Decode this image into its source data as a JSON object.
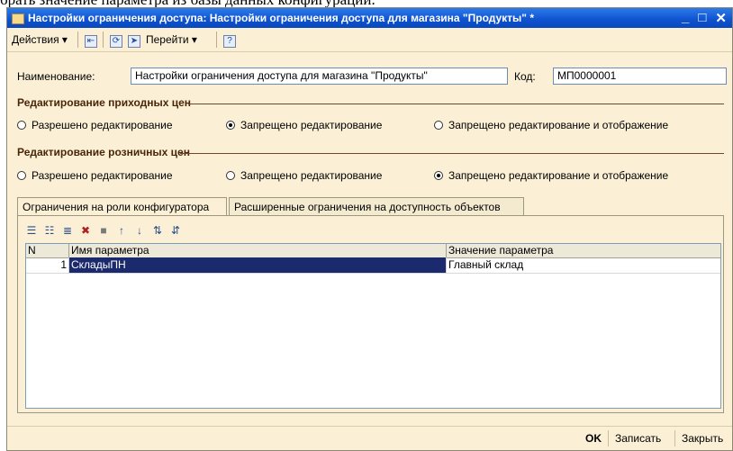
{
  "caption": "брать значение параметра из базы данных конфигурации.",
  "window": {
    "title": "Настройки ограничения доступа: Настройки ограничения доступа для магазина \"Продукты\" *",
    "min_glyph": "_",
    "max_glyph": "□",
    "close_glyph": "✕"
  },
  "toolbar": {
    "actions_label": "Действия",
    "goto_label": "Перейти",
    "dropdown_glyph": "▾",
    "help_glyph": "?"
  },
  "form": {
    "name_label": "Наименование:",
    "name_value": "Настройки ограничения доступа для магазина \"Продукты\"",
    "code_label": "Код:",
    "code_value": "МП0000001"
  },
  "incoming_prices": {
    "title": "Редактирование приходных цен",
    "options": [
      "Разрешено редактирование",
      "Запрещено редактирование",
      "Запрещено редактирование и отображение"
    ],
    "selected": 1
  },
  "retail_prices": {
    "title": "Редактирование розничных цен",
    "options": [
      "Разрешено редактирование",
      "Запрещено редактирование",
      "Запрещено редактирование и отображение"
    ],
    "selected": 2
  },
  "tabs": [
    "Ограничения на роли конфигуратора",
    "Расширенные ограничения на доступность объектов"
  ],
  "grid": {
    "columns": [
      "N",
      "Имя параметра",
      "Значение параметра"
    ],
    "rows": [
      {
        "n": "1",
        "name": "СкладыПН",
        "value": "Главный склад"
      }
    ]
  },
  "bottom": {
    "ok_label": "OK",
    "save_label": "Записать",
    "close_label": "Закрыть"
  }
}
